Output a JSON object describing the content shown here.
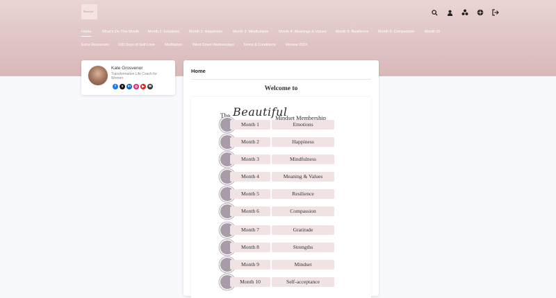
{
  "header": {
    "logo_text": "Beautiful",
    "icons": [
      "search-icon",
      "user-icon",
      "community-icon",
      "settings-icon",
      "logout-icon"
    ]
  },
  "nav_row1": [
    {
      "label": "Home"
    },
    {
      "label": "What's On This Month"
    },
    {
      "label": "Month 1: Emotions"
    },
    {
      "label": "Month 2: Happiness"
    },
    {
      "label": "Month 3: Mindfulness"
    },
    {
      "label": "Month 4: Meanings & Values"
    },
    {
      "label": "Month 5: Resilience"
    },
    {
      "label": "Month 6: Compassion"
    },
    {
      "label": "Month 15"
    }
  ],
  "nav_row2": [
    {
      "label": "Extra Resources"
    },
    {
      "label": "100 Days of Self Love"
    },
    {
      "label": "Meditation"
    },
    {
      "label": "Wind Down Wednesdays"
    },
    {
      "label": "Terms & Conditions"
    },
    {
      "label": "Review 2024"
    }
  ],
  "profile": {
    "name": "Kate Grosvenor",
    "role": "Transformation Life Coach for Women",
    "socials": [
      "facebook-icon",
      "x-icon",
      "linkedin-icon",
      "instagram-icon",
      "youtube-icon",
      "email-icon"
    ]
  },
  "main": {
    "title": "Home",
    "welcome": "Welcome to",
    "heading_the": "The",
    "heading_beautiful": "Beautiful",
    "heading_rest": "Mindset Membership",
    "months": [
      {
        "month": "Month 1",
        "topic": "Emotions"
      },
      {
        "month": "Month 2",
        "topic": "Happiness"
      },
      {
        "month": "Month 3",
        "topic": "Mindfulness"
      },
      {
        "month": "Month 4",
        "topic": "Meaning & Values"
      },
      {
        "month": "Month 5",
        "topic": "Resilience"
      },
      {
        "month": "Month 6",
        "topic": "Compassion"
      },
      {
        "month": "Month 7",
        "topic": "Gratitude"
      },
      {
        "month": "Month 8",
        "topic": "Strengths"
      },
      {
        "month": "Month 9",
        "topic": "Mindset"
      },
      {
        "month": "Month 10",
        "topic": "Self-acceptance"
      }
    ]
  },
  "colors": {
    "banner_top": "#e9d4d4",
    "banner_bottom": "#d8b8b8",
    "label_bg": "#f1e2e3",
    "circle": "#a89ca8"
  }
}
